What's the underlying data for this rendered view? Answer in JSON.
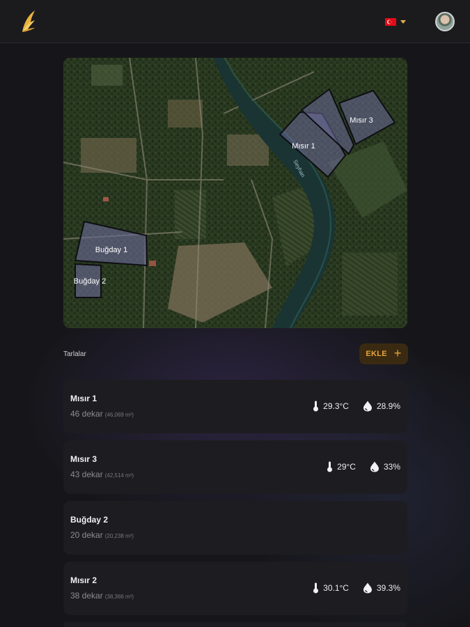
{
  "header": {
    "logo_icon": "wing-logo-icon",
    "language_flag": "turkey-flag-icon",
    "accent_color": "#e8a43a"
  },
  "map": {
    "fields": [
      {
        "label": "Mısır 1"
      },
      {
        "label": "Mısır 3"
      },
      {
        "label": "Buğday 1"
      },
      {
        "label": "Buğday 2"
      }
    ],
    "river_label": "Seyhan"
  },
  "section": {
    "title": "Tarlalar",
    "add_label": "EKLE"
  },
  "fields": [
    {
      "name": "Mısır 1",
      "area": "46 dekar",
      "area_m2": "(46,069 m²)",
      "temperature": "29.3°C",
      "humidity": "28.9%"
    },
    {
      "name": "Mısır 3",
      "area": "43 dekar",
      "area_m2": "(42,514 m²)",
      "temperature": "29°C",
      "humidity": "33%"
    },
    {
      "name": "Buğday 2",
      "area": "20 dekar",
      "area_m2": "(20,238 m²)",
      "temperature": "",
      "humidity": ""
    },
    {
      "name": "Mısır 2",
      "area": "38 dekar",
      "area_m2": "(38,366 m²)",
      "temperature": "30.1°C",
      "humidity": "39.3%"
    }
  ]
}
